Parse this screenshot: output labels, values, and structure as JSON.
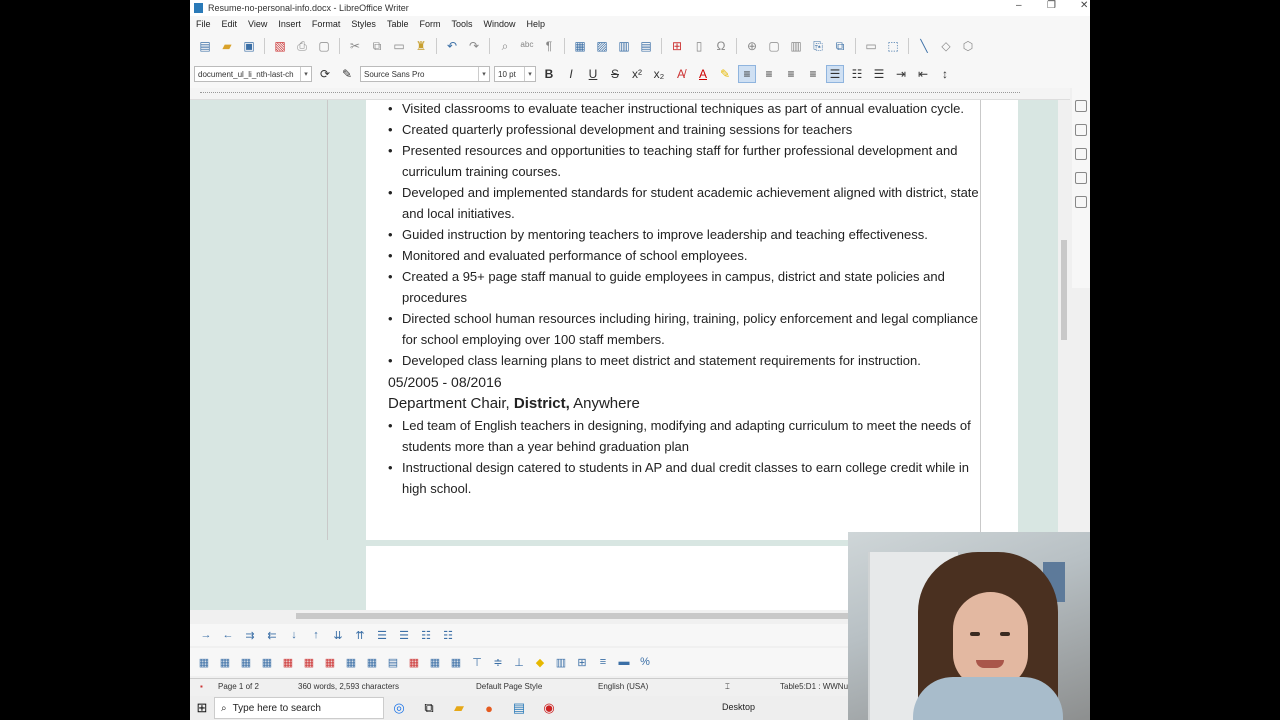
{
  "window": {
    "title": "Resume-no-personal-info.docx - LibreOffice Writer",
    "controls": {
      "minimize": "–",
      "restore": "❐",
      "close": "✕"
    }
  },
  "menu": [
    "File",
    "Edit",
    "View",
    "Insert",
    "Format",
    "Styles",
    "Table",
    "Form",
    "Tools",
    "Window",
    "Help"
  ],
  "format_bar": {
    "paragraph_style": "document_ul_li_nth-last-ch",
    "font_name": "Source Sans Pro",
    "font_size": "10 pt"
  },
  "document": {
    "bullets_top": [
      "Visited classrooms to evaluate teacher instructional techniques as part of annual evaluation cycle.",
      "Created quarterly professional development and training sessions for teachers",
      "Presented resources and opportunities to teaching staff for further professional development and curriculum training courses.",
      "Developed and implemented standards for student academic achievement aligned with district, state and local initiatives.",
      "Guided instruction by mentoring teachers to improve leadership and teaching effectiveness.",
      "Monitored and evaluated performance of school employees.",
      "Created a 95+ page staff manual to guide employees in campus, district and state policies and procedures",
      "Directed school human resources including hiring, training, policy enforcement and legal compliance for school employing over 100 staff members.",
      "Developed class learning plans to meet district and statement requirements for instruction."
    ],
    "date_range": "05/2005 - 08/2016",
    "job_title": "Department Chair,",
    "employer": "District,",
    "location": "Anywhere",
    "bullets_bottom": [
      "Led team of English teachers in designing, modifying and adapting curriculum to meet the needs of students more than a year behind graduation plan",
      "Instructional design catered to students in AP and dual credit classes to earn college credit while in high school."
    ]
  },
  "status": {
    "page": "Page 1 of 2",
    "words": "360 words, 2,593 characters",
    "page_style": "Default Page Style",
    "language": "English (USA)",
    "cell": "Table5:D1 : WWNu"
  },
  "taskbar": {
    "search_placeholder": "Type here to search",
    "desktop_label": "Desktop"
  }
}
